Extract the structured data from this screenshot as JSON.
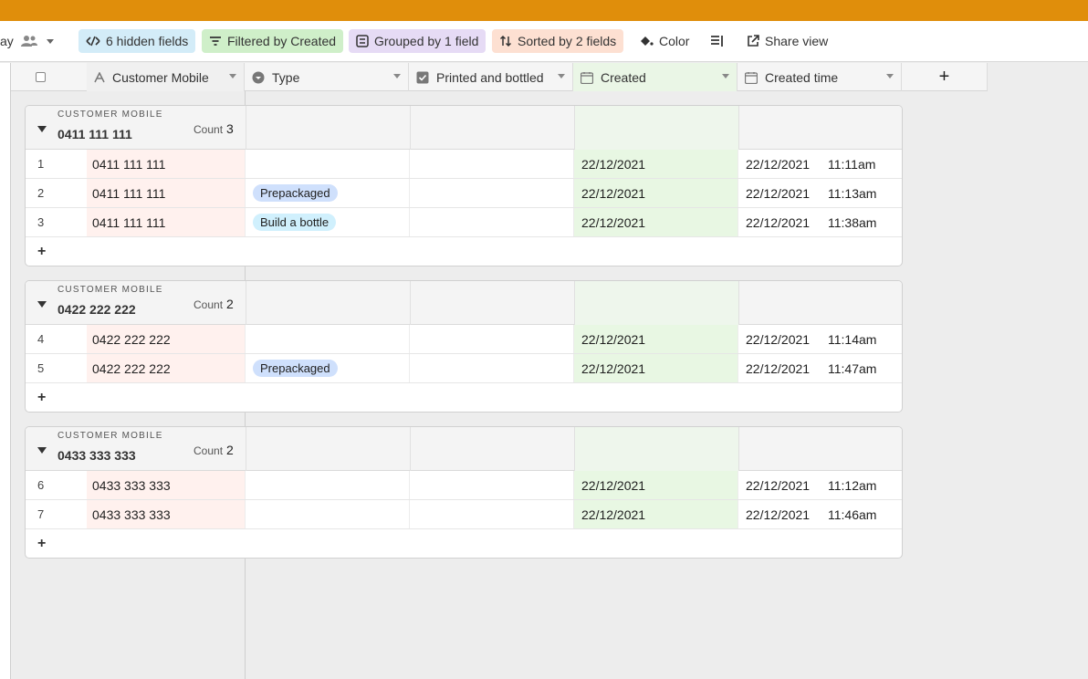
{
  "toolbar": {
    "view_label_fragment": "ay",
    "hidden_fields": "6 hidden fields",
    "filtered": "Filtered by Created",
    "grouped": "Grouped by 1 field",
    "sorted": "Sorted by 2 fields",
    "color": "Color",
    "share": "Share view",
    "colors": {
      "hidden_bg": "#d3ecf8",
      "filter_bg": "#cfefc9",
      "group_bg": "#e6dbf5",
      "sort_bg": "#fde0d2",
      "topbar": "#e08e0b"
    }
  },
  "columns": {
    "customer_mobile": "Customer Mobile",
    "type": "Type",
    "printed": "Printed and bottled",
    "created": "Created",
    "created_time": "Created time",
    "add": "+"
  },
  "groups": [
    {
      "label": "CUSTOMER MOBILE",
      "value": "0411 111 111",
      "count_label": "Count",
      "count": "3",
      "rows": [
        {
          "num": "1",
          "mobile": "0411 111 111",
          "type": "",
          "created": "22/12/2021",
          "date": "22/12/2021",
          "time": "11:11am"
        },
        {
          "num": "2",
          "mobile": "0411 111 111",
          "type": "Prepackaged",
          "created": "22/12/2021",
          "date": "22/12/2021",
          "time": "11:13am"
        },
        {
          "num": "3",
          "mobile": "0411 111 111",
          "type": "Build a bottle",
          "created": "22/12/2021",
          "date": "22/12/2021",
          "time": "11:38am"
        }
      ]
    },
    {
      "label": "CUSTOMER MOBILE",
      "value": "0422 222 222",
      "count_label": "Count",
      "count": "2",
      "rows": [
        {
          "num": "4",
          "mobile": "0422 222 222",
          "type": "",
          "created": "22/12/2021",
          "date": "22/12/2021",
          "time": "11:14am"
        },
        {
          "num": "5",
          "mobile": "0422 222 222",
          "type": "Prepackaged",
          "created": "22/12/2021",
          "date": "22/12/2021",
          "time": "11:47am"
        }
      ]
    },
    {
      "label": "CUSTOMER MOBILE",
      "value": "0433 333 333",
      "count_label": "Count",
      "count": "2",
      "rows": [
        {
          "num": "6",
          "mobile": "0433 333 333",
          "type": "",
          "created": "22/12/2021",
          "date": "22/12/2021",
          "time": "11:12am"
        },
        {
          "num": "7",
          "mobile": "0433 333 333",
          "type": "",
          "created": "22/12/2021",
          "date": "22/12/2021",
          "time": "11:46am"
        }
      ]
    }
  ],
  "add_row_label": "+",
  "tag_colors": {
    "Prepackaged": "#cfe0fc",
    "Build a bottle": "#d0f0fd"
  }
}
